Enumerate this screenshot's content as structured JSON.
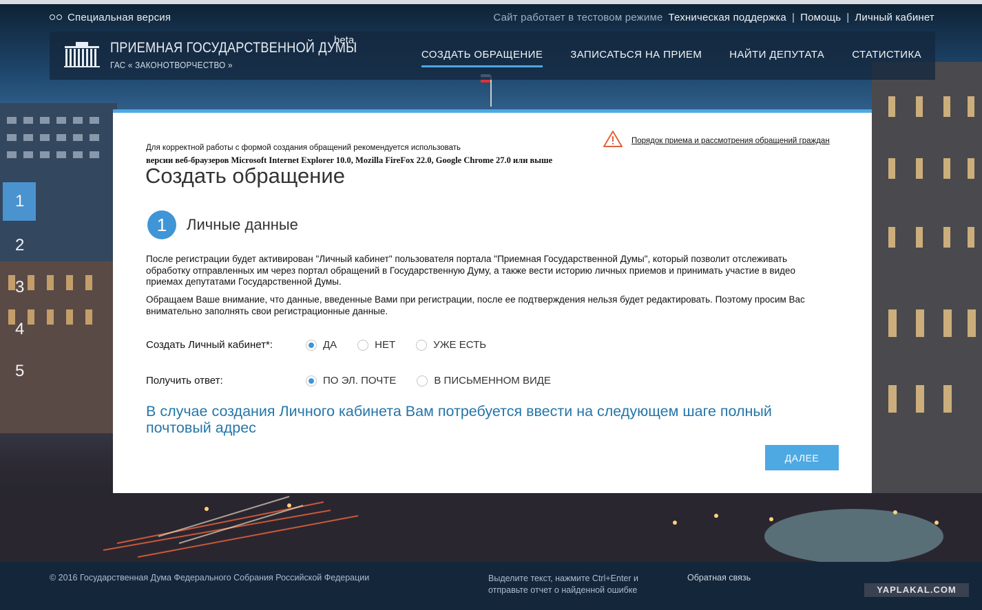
{
  "util": {
    "special_version": "Специальная версия",
    "test_mode": "Сайт работает в тестовом режиме",
    "support": "Техническая поддержка",
    "help": "Помощь",
    "cabinet": "Личный кабинет",
    "sep": "|"
  },
  "header": {
    "brand_title": "ПРИЕМНАЯ ГОСУДАРСТВЕННОЙ ДУМЫ",
    "brand_sub": "ГАС « ЗАКОНОТВОРЧЕСТВО »",
    "beta": "beta",
    "nav": [
      {
        "label": "СОЗДАТЬ ОБРАЩЕНИЕ"
      },
      {
        "label": "ЗАПИСАТЬСЯ НА ПРИЕМ"
      },
      {
        "label": "НАЙТИ ДЕПУТАТА"
      },
      {
        "label": "СТАТИСТИКА"
      }
    ]
  },
  "steps": [
    "1",
    "2",
    "3",
    "4",
    "5"
  ],
  "card": {
    "rules_link": "Порядок приема и рассмотрения обращений граждан",
    "note_line1": "Для корректной работы с формой создания обращений рекомендуется использовать",
    "note_line2": "версии веб-браузеров Microsoft Internet Explorer 10.0, Mozilla FireFox 22.0, Google Chrome 27.0 или выше",
    "title": "Создать обращение",
    "step_number": "1",
    "step_title": "Личные данные",
    "para1": "После регистрации будет активирован \"Личный кабинет\" пользователя портала \"Приемная Государственной Думы\", который позволит отслеживать обработку отправленных им через портал обращений в Государственную Думу, а также вести историю личных приемов и принимать участие в видео приемах депутатами Государственной Думы.",
    "para2": "Обращаем Ваше внимание, что данные, введенные Вами при регистрации, после ее подтверждения нельзя будет редактировать. Поэтому просим Вас внимательно заполнять свои регистрационные данные.",
    "create_cabinet_label": "Создать Личный кабинет*:",
    "create_options": [
      "ДА",
      "НЕТ",
      "УЖЕ ЕСТЬ"
    ],
    "create_selected": "ДА",
    "reply_label": "Получить ответ:",
    "reply_options": [
      "ПО ЭЛ. ПОЧТЕ",
      "В ПИСЬМЕННОМ ВИДЕ"
    ],
    "reply_selected": "ПО ЭЛ. ПОЧТЕ",
    "info": "В случае создания Личного кабинета Вам потребуется ввести на следующем шаге полный почтовый адрес",
    "next_button": "ДАЛЕЕ"
  },
  "footer": {
    "copyright": "© 2016 Государственная Дума Федерального Собрания Российской Федерации",
    "report_line1": "Выделите текст, нажмите Ctrl+Enter и",
    "report_line2": "отправьте отчет о найденной ошибке",
    "feedback": "Обратная связь",
    "watermark": "YAPLAKAL.COM"
  },
  "colors": {
    "accent": "#4ea9e3",
    "step_circle": "#3f95d6",
    "info_text": "#2576a8",
    "header_band": "#14283e",
    "footer": "#13263a"
  }
}
